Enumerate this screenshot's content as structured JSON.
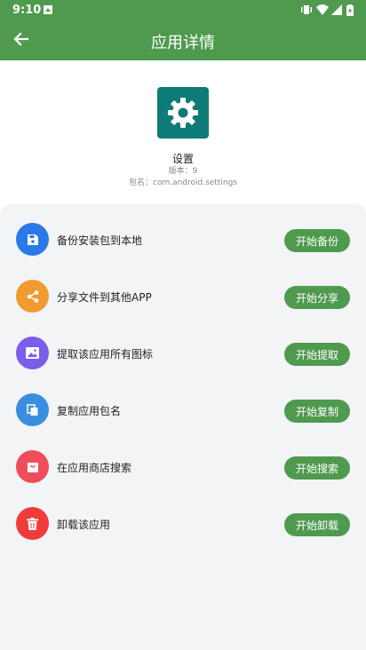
{
  "status_bar": {
    "time": "9:10"
  },
  "app_bar": {
    "title": "应用详情"
  },
  "app": {
    "name": "设置",
    "version": "版本：9",
    "package": "包名：com.android.settings"
  },
  "actions": [
    {
      "label": "备份安装包到本地",
      "button": "开始备份",
      "color": "#2979e8",
      "icon": "save-icon"
    },
    {
      "label": "分享文件到其他APP",
      "button": "开始分享",
      "color": "#f09a30",
      "icon": "share-icon"
    },
    {
      "label": "提取该应用所有图标",
      "button": "开始提取",
      "color": "#7b5cec",
      "icon": "image-icon"
    },
    {
      "label": "复制应用包名",
      "button": "开始复制",
      "color": "#3a8ee0",
      "icon": "copy-icon"
    },
    {
      "label": "在应用商店搜索",
      "button": "开始搜索",
      "color": "#f04c5c",
      "icon": "store-icon"
    },
    {
      "label": "卸载该应用",
      "button": "开始卸载",
      "color": "#ef3b3b",
      "icon": "trash-icon"
    }
  ]
}
